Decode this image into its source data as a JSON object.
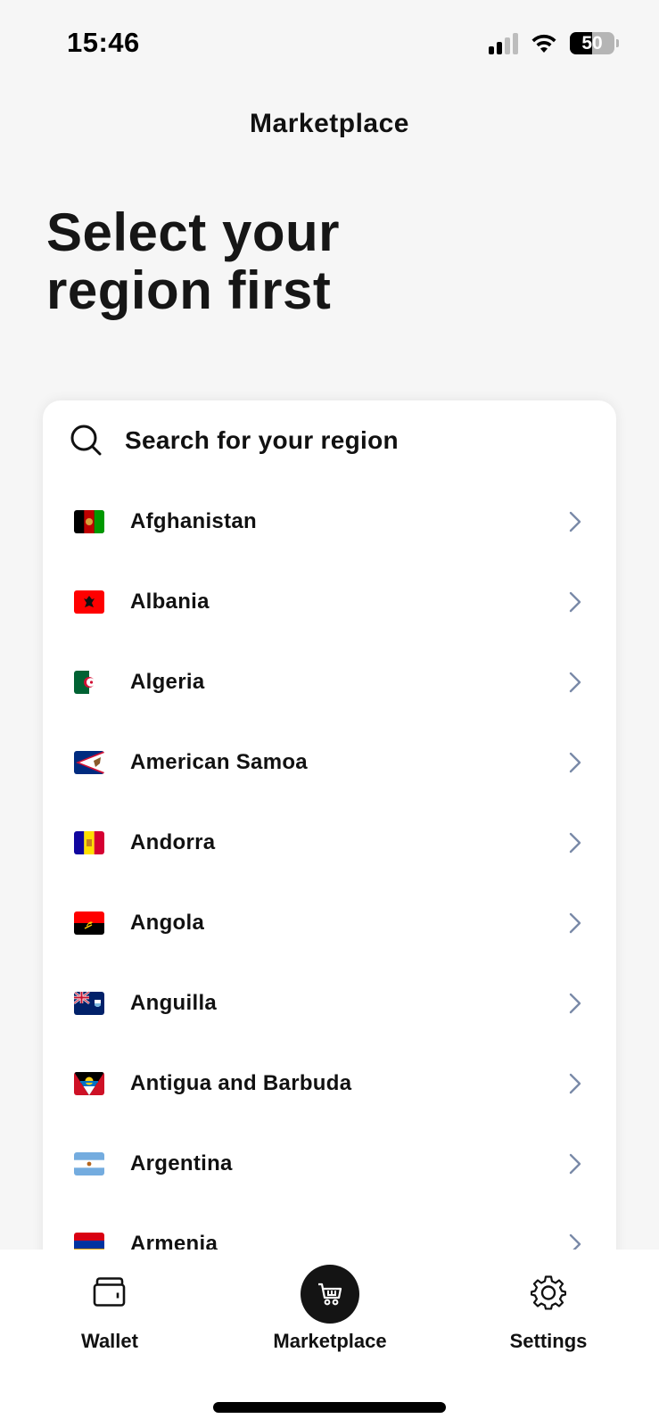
{
  "status_bar": {
    "time": "15:46",
    "battery_level": "50",
    "signal_bars_active": 2,
    "signal_bars_total": 4,
    "icons": [
      "signal-icon",
      "wifi-icon",
      "battery-icon"
    ]
  },
  "header": {
    "title": "Marketplace"
  },
  "heading": {
    "line1": "Select your",
    "line2_bold": "region",
    "line2_rest": " first"
  },
  "search": {
    "placeholder": "Search for your region",
    "icon": "search-icon"
  },
  "regions": [
    {
      "name": "Afghanistan",
      "flag": "af"
    },
    {
      "name": "Albania",
      "flag": "al"
    },
    {
      "name": "Algeria",
      "flag": "dz"
    },
    {
      "name": "American Samoa",
      "flag": "as"
    },
    {
      "name": "Andorra",
      "flag": "ad"
    },
    {
      "name": "Angola",
      "flag": "ao"
    },
    {
      "name": "Anguilla",
      "flag": "ai"
    },
    {
      "name": "Antigua and Barbuda",
      "flag": "ag"
    },
    {
      "name": "Argentina",
      "flag": "ar"
    },
    {
      "name": "Armenia",
      "flag": "am"
    }
  ],
  "tabbar": {
    "tabs": [
      {
        "label": "Wallet",
        "icon": "wallet-icon",
        "active": false
      },
      {
        "label": "Marketplace",
        "icon": "cart-icon",
        "active": true
      },
      {
        "label": "Settings",
        "icon": "gear-icon",
        "active": false
      }
    ]
  },
  "colors": {
    "background": "#f6f6f6",
    "card": "#ffffff",
    "text": "#111111",
    "chevron": "#7a8aa8",
    "active_tab_bg": "#141414"
  }
}
